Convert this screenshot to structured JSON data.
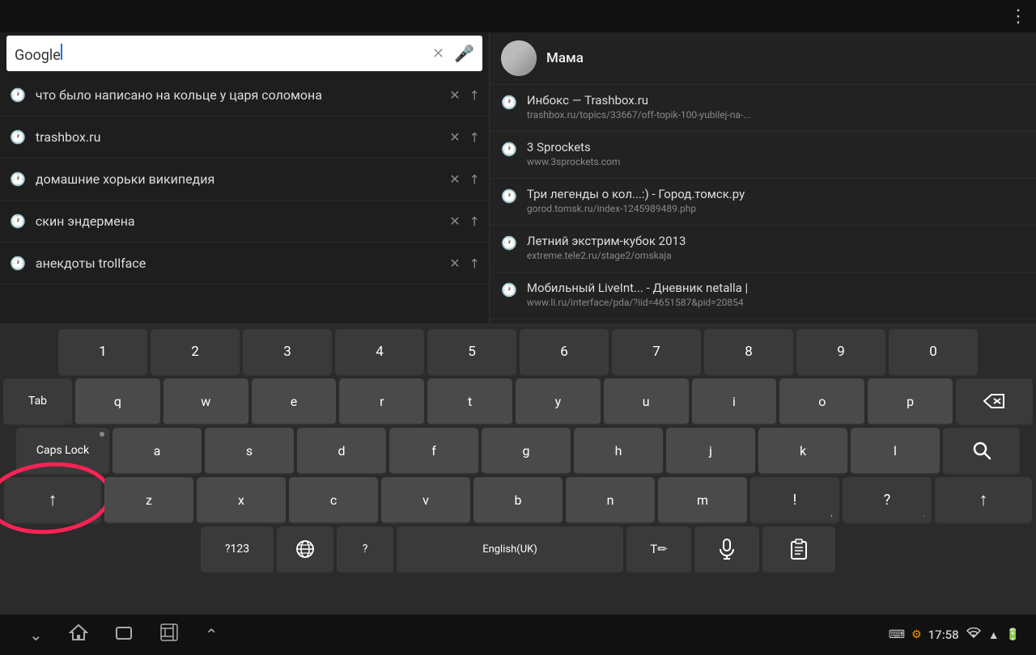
{
  "topbar": {
    "menu_icon": "⋮"
  },
  "search": {
    "placeholder": "Google",
    "text": "Google"
  },
  "suggestions": [
    {
      "text": "что было написано на кольце у царя соломона",
      "type": "history"
    },
    {
      "text": "trashbox.ru",
      "type": "history"
    },
    {
      "text": "домашние хорьки википедия",
      "type": "history"
    },
    {
      "text": "скин эндермена",
      "type": "history"
    },
    {
      "text": "анекдоты trollface",
      "type": "history"
    }
  ],
  "right_panel": {
    "contact": {
      "name": "Мама"
    },
    "history": [
      {
        "title": "Инбокс — Trashbox.ru",
        "url": "trashbox.ru/topics/33667/off-topik-100-yubilej-na-..."
      },
      {
        "title": "3 Sprockets",
        "url": "www.3sprockets.com"
      },
      {
        "title": "Три легенды о кол...:) - Город.томск.ру",
        "url": "gorod.tomsk.ru/index-1245989489.php"
      },
      {
        "title": "Летний экстрим-кубок 2013",
        "url": "extreme.tele2.ru/stage2/omskaja"
      },
      {
        "title": "Мобильный LiveInt... - Дневник netalla |",
        "url": "www.li.ru/interface/pda/?iid=4651587&pid=20854"
      }
    ]
  },
  "keyboard": {
    "row1": [
      "1",
      "2",
      "3",
      "4",
      "5",
      "6",
      "7",
      "8",
      "9",
      "0"
    ],
    "row2": [
      "q",
      "w",
      "e",
      "r",
      "t",
      "y",
      "u",
      "i",
      "o",
      "p"
    ],
    "row3": [
      "a",
      "s",
      "d",
      "f",
      "g",
      "h",
      "j",
      "k",
      "l"
    ],
    "row4": [
      "z",
      "x",
      "c",
      "v",
      "b",
      "n",
      "m",
      "!",
      "?"
    ],
    "labels": {
      "tab": "Tab",
      "caps": "Caps Lock",
      "shift_l": "↑",
      "shift_r": "↑",
      "backspace": "⌫",
      "search": "🔍",
      "num123": "?123",
      "globe": "🌐",
      "question": "?",
      "space": "English(UK)",
      "tdwriter": "T✏",
      "mic": "🎤",
      "clipboard": "📋"
    }
  },
  "bottom_nav": {
    "back": "⌄",
    "home": "⌂",
    "recent": "▭",
    "screenshot": "⊞",
    "up": "⌃"
  },
  "status_bar": {
    "time": "17:58",
    "wifi": "WiFi",
    "signal": "▲",
    "battery": "▮"
  }
}
